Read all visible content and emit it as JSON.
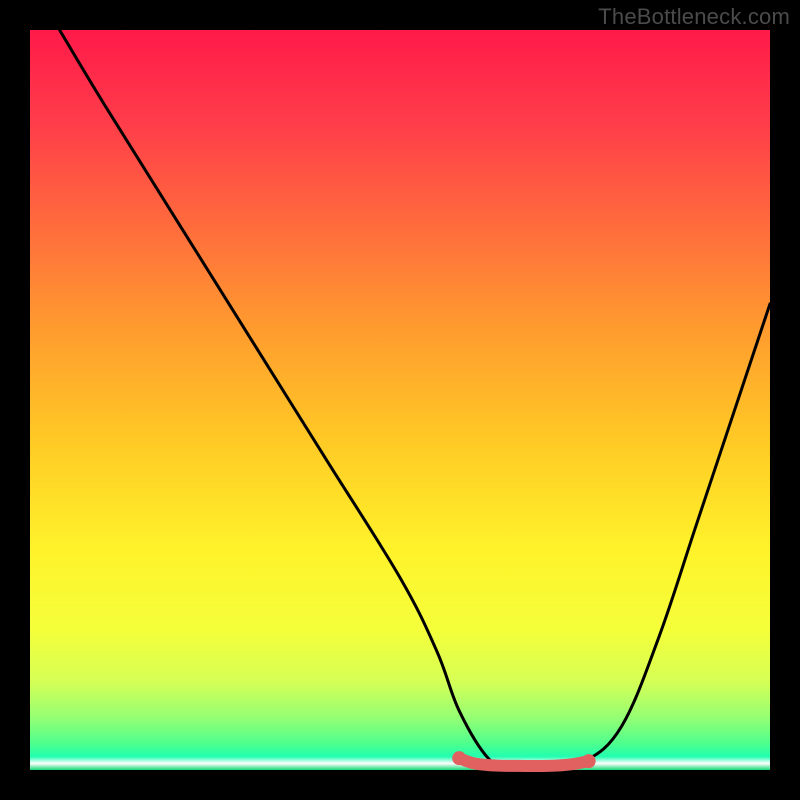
{
  "watermark": "TheBottleneck.com",
  "chart_data": {
    "type": "line",
    "title": "",
    "xlabel": "",
    "ylabel": "",
    "xlim": [
      0,
      100
    ],
    "ylim": [
      0,
      100
    ],
    "series": [
      {
        "name": "bottleneck-curve",
        "color": "#000000",
        "x": [
          4,
          10,
          20,
          30,
          40,
          50,
          55,
          58,
          62,
          65,
          70,
          75,
          80,
          85,
          90,
          95,
          100
        ],
        "y": [
          100,
          90,
          74,
          58,
          42,
          26,
          16,
          8,
          1.5,
          0.5,
          0.5,
          1.2,
          6,
          18,
          33,
          48,
          63
        ]
      },
      {
        "name": "flat-zone-marker",
        "color": "#e16060",
        "x": [
          58,
          60,
          63,
          66,
          70,
          73,
          75.5
        ],
        "y": [
          1.6,
          0.9,
          0.6,
          0.55,
          0.55,
          0.75,
          1.2
        ]
      }
    ],
    "gradient_stops": [
      {
        "pos": 0,
        "color": "#ff1a49"
      },
      {
        "pos": 12,
        "color": "#ff3b4a"
      },
      {
        "pos": 26,
        "color": "#ff6a3d"
      },
      {
        "pos": 40,
        "color": "#ff9a2f"
      },
      {
        "pos": 55,
        "color": "#ffc825"
      },
      {
        "pos": 70,
        "color": "#fff22a"
      },
      {
        "pos": 81,
        "color": "#f4ff3a"
      },
      {
        "pos": 88,
        "color": "#d6ff55"
      },
      {
        "pos": 93,
        "color": "#94ff74"
      },
      {
        "pos": 96.5,
        "color": "#4cff8e"
      },
      {
        "pos": 98.2,
        "color": "#22ffb0"
      },
      {
        "pos": 99.1,
        "color": "#ffffff"
      },
      {
        "pos": 100,
        "color": "#14d977"
      }
    ]
  }
}
